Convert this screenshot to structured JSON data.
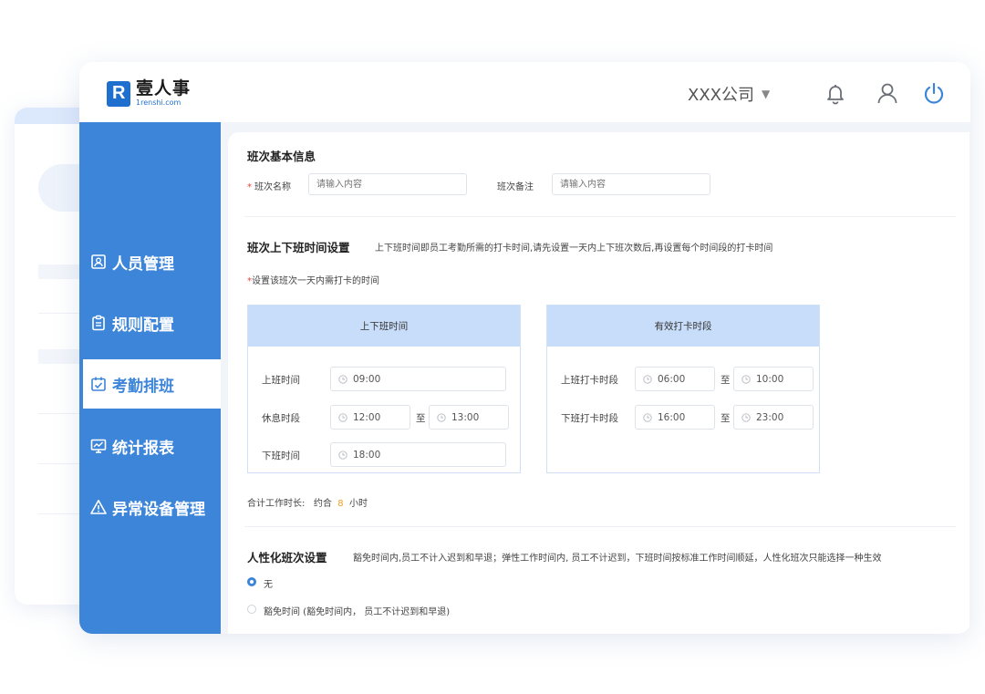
{
  "header": {
    "logo_cn": "壹人事",
    "logo_en": "1renshi.com",
    "company": "XXX公司"
  },
  "icons": {
    "caret": "caret-down-icon",
    "bell": "bell-icon",
    "user": "user-icon",
    "power": "power-icon",
    "clock": "clock-icon"
  },
  "colors": {
    "primary": "#3d85d9",
    "panel_header": "#c8ddfa",
    "required": "#e0463a",
    "highlight": "#f0a020"
  },
  "sidebar": {
    "items": [
      {
        "label": "人员管理",
        "icon": "person-card-icon",
        "active": false
      },
      {
        "label": "规则配置",
        "icon": "clipboard-icon",
        "active": false
      },
      {
        "label": "考勤排班",
        "icon": "calendar-check-icon",
        "active": true
      },
      {
        "label": "统计报表",
        "icon": "chart-board-icon",
        "active": false
      },
      {
        "label": "异常设备管理",
        "icon": "warning-icon",
        "active": false
      }
    ]
  },
  "basic": {
    "title": "班次基本信息",
    "name_label": "班次名称",
    "name_placeholder": "请输入内容",
    "remark_label": "班次备注",
    "remark_placeholder": "请输入内容"
  },
  "timeset": {
    "title": "班次上下班时间设置",
    "desc": "上下班时间即员工考勤所需的打卡时间,请先设置一天内上下班次数后,再设置每个时间段的打卡时间",
    "note": "设置该班次一天内需打卡的时间",
    "work_panel": {
      "title": "上下班时间",
      "start_label": "上班时间",
      "start": "09:00",
      "rest_label": "休息时段",
      "rest_from": "12:00",
      "to": "至",
      "rest_to": "13:00",
      "end_label": "下班时间",
      "end": "18:00"
    },
    "punch_panel": {
      "title": "有效打卡时段",
      "in_label": "上班打卡时段",
      "in_from": "06:00",
      "to": "至",
      "in_to": "10:00",
      "out_label": "下班打卡时段",
      "out_from": "16:00",
      "out_to": "23:00"
    },
    "total_label": "合计工作时长:",
    "total_prefix": "约合",
    "total_hours": "8",
    "total_unit": "小时"
  },
  "humanized": {
    "title": "人性化班次设置",
    "desc": "豁免时间内,员工不计入迟到和早退；弹性工作时间内, 员工不计迟到，下班时间按标准工作时间顺延，人性化班次只能选择一种生效",
    "options": [
      {
        "label": "无",
        "selected": true
      },
      {
        "label": "豁免时间 (豁免时间内， 员工不计迟到和早退)",
        "selected": false
      }
    ]
  }
}
